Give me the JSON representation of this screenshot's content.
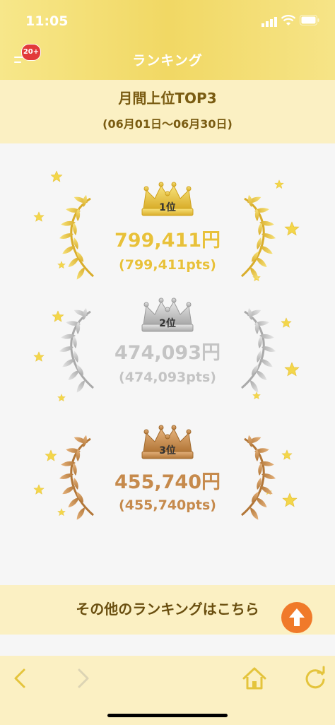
{
  "status": {
    "time": "11:05"
  },
  "header": {
    "title": "ランキング",
    "badge": "20+"
  },
  "subheader": {
    "title": "月間上位TOP3",
    "range": "(06月01日〜06月30日)"
  },
  "ranks": [
    {
      "label": "1位",
      "amount": "799,411円",
      "pts": "(799,411pts)"
    },
    {
      "label": "2位",
      "amount": "474,093円",
      "pts": "(474,093pts)"
    },
    {
      "label": "3位",
      "amount": "455,740円",
      "pts": "(455,740pts)"
    }
  ],
  "footer": {
    "link_text": "その他のランキングはこちら"
  },
  "colors": {
    "gold": "#e8c13a",
    "silver": "#c4c4c4",
    "bronze": "#c68a4c",
    "accent": "#f07a2a",
    "header": "#f1d864"
  },
  "icons": [
    "menu-icon",
    "crown-icon",
    "laurel-icon",
    "star-icon",
    "arrow-up-icon",
    "back-icon",
    "forward-icon",
    "home-icon",
    "reload-icon"
  ]
}
